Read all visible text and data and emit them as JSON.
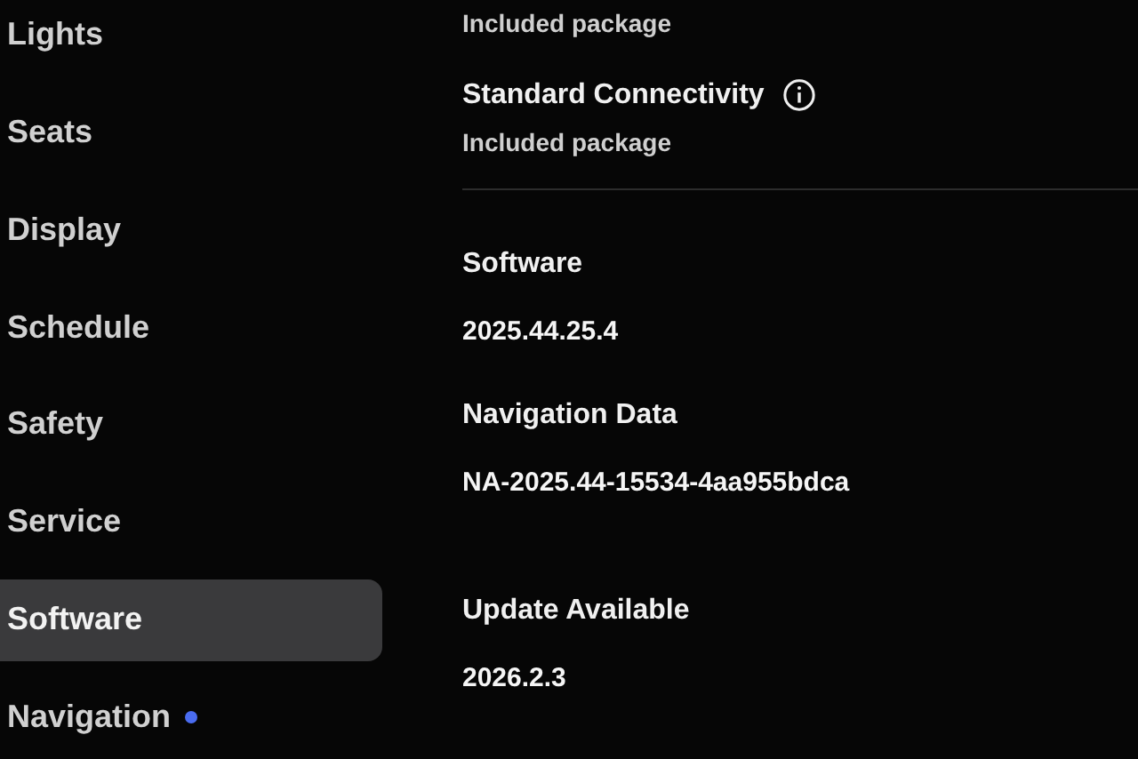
{
  "sidebar": {
    "items": [
      {
        "label": "Lights",
        "selected": false,
        "badge": false
      },
      {
        "label": "Seats",
        "selected": false,
        "badge": false
      },
      {
        "label": "Display",
        "selected": false,
        "badge": false
      },
      {
        "label": "Schedule",
        "selected": false,
        "badge": false
      },
      {
        "label": "Safety",
        "selected": false,
        "badge": false
      },
      {
        "label": "Service",
        "selected": false,
        "badge": false
      },
      {
        "label": "Software",
        "selected": true,
        "badge": false
      },
      {
        "label": "Navigation",
        "selected": false,
        "badge": true
      }
    ]
  },
  "content": {
    "top_note": "Included package",
    "connectivity": {
      "title": "Standard Connectivity",
      "value": "Included package"
    },
    "sections": [
      {
        "title": "Software",
        "value": "2025.44.25.4"
      },
      {
        "title": "Navigation Data",
        "value": "NA-2025.44-15534-4aa955bdca"
      },
      {
        "title": "Update Available",
        "value": "2026.2.3"
      }
    ]
  }
}
